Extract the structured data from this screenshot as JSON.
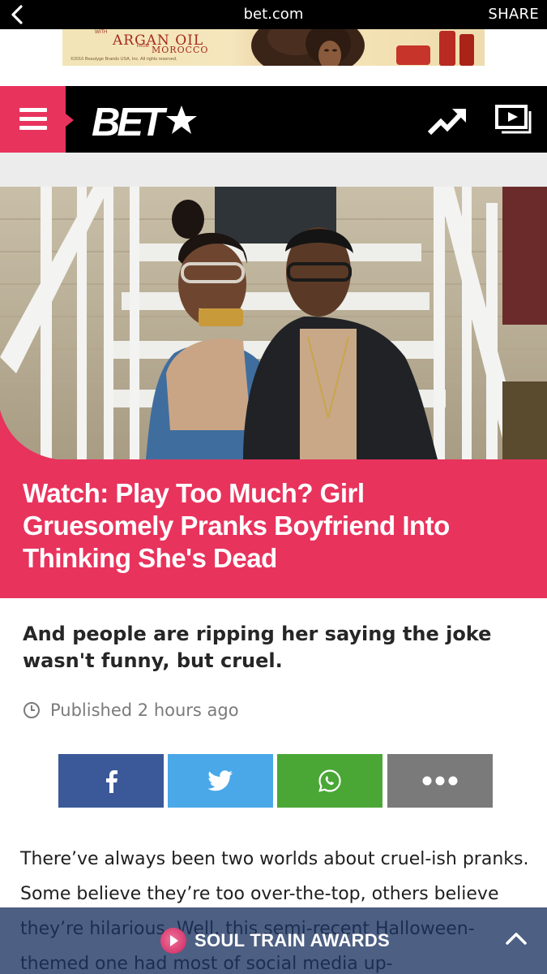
{
  "browser": {
    "url": "bet.com",
    "share_label": "SHARE"
  },
  "ad": {
    "brand_prefix": "WITH",
    "brand_line1": "ARGAN OIL",
    "brand_from": "FROM",
    "brand_line2": "MOROCCO",
    "copyright": "©2016 Beautyge Brands USA, Inc. All rights reserved."
  },
  "nav": {
    "logo_text": "BET",
    "icons": [
      "menu-icon",
      "trending-icon",
      "video-icon"
    ]
  },
  "article": {
    "headline": "Watch: Play Too Much? Girl Gruesomely Pranks Boyfriend Into Thinking She's Dead",
    "dek": "And people are ripping her saying the joke wasn't funny, but cruel.",
    "published": "Published 2 hours ago",
    "body": "There’ve always been two worlds about cruel-ish pranks. Some believe they’re too over-the-top, others believe they’re hilarious. Well, this semi-recent Halloween-themed one had most of social media up-"
  },
  "share_buttons": [
    {
      "name": "facebook",
      "icon": "facebook-icon",
      "color": "#3b5998"
    },
    {
      "name": "twitter",
      "icon": "twitter-icon",
      "color": "#4aa8e8"
    },
    {
      "name": "whatsapp",
      "icon": "whatsapp-icon",
      "color": "#4aa736"
    },
    {
      "name": "more",
      "icon": "more-dots-icon",
      "color": "#7a7a7a"
    }
  ],
  "bottom_bar": {
    "promo_label": "SOUL TRAIN AWARDS"
  },
  "colors": {
    "accent": "#e8335d",
    "nav_bg": "#000000"
  }
}
